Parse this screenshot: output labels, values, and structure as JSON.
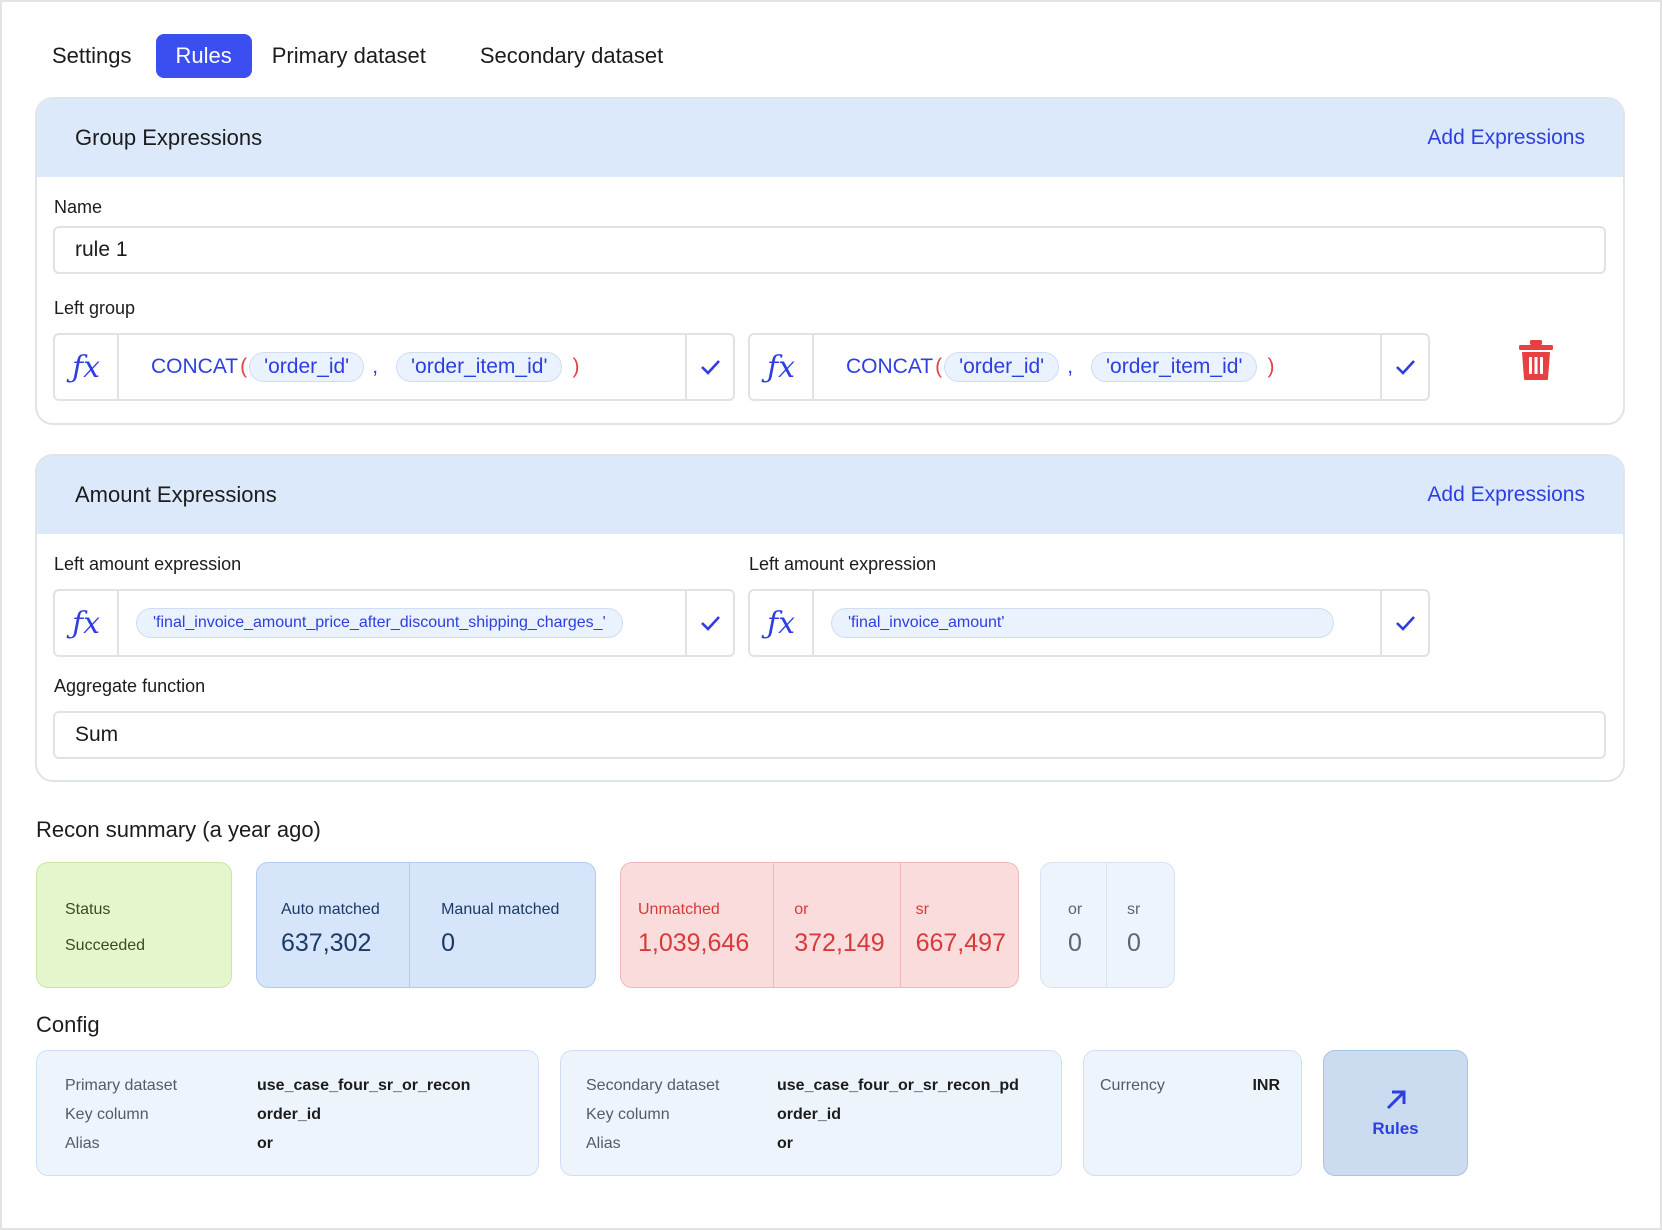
{
  "tabs": [
    {
      "label": "Settings",
      "active": false
    },
    {
      "label": "Rules",
      "active": true
    },
    {
      "label": "Primary dataset",
      "active": false
    },
    {
      "label": "Secondary dataset",
      "active": false
    }
  ],
  "group_expressions": {
    "title": "Group Expressions",
    "add_label": "Add Expressions",
    "name_label": "Name",
    "name_value": "rule 1",
    "left_group_label": "Left group",
    "expressions": [
      {
        "fn": "CONCAT",
        "args": [
          "'order_id'",
          "'order_item_id'"
        ]
      },
      {
        "fn": "CONCAT",
        "args": [
          "'order_id'",
          "'order_item_id'"
        ]
      }
    ]
  },
  "amount_expressions": {
    "title": "Amount Expressions",
    "add_label": "Add Expressions",
    "left_label_1": "Left amount expression",
    "left_label_2": "Left amount expression",
    "expr_1": "'final_invoice_amount_price_after_discount_shipping_charges_'",
    "expr_2": "'final_invoice_amount'",
    "aggregate_label": "Aggregate function",
    "aggregate_value": "Sum"
  },
  "recon_summary": {
    "title": "Recon summary (a year ago)",
    "status_label": "Status",
    "status_value": "Succeeded",
    "auto_matched_label": "Auto matched",
    "auto_matched_value": "637,302",
    "manual_matched_label": "Manual matched",
    "manual_matched_value": "0",
    "unmatched_label": "Unmatched",
    "unmatched_value": "1,039,646",
    "unmatched_or_label": "or",
    "unmatched_or_value": "372,149",
    "unmatched_sr_label": "sr",
    "unmatched_sr_value": "667,497",
    "extra_or_label": "or",
    "extra_or_value": "0",
    "extra_sr_label": "sr",
    "extra_sr_value": "0"
  },
  "config": {
    "title": "Config",
    "primary": {
      "dataset_key": "Primary dataset",
      "dataset_val": "use_case_four_sr_or_recon",
      "key_column_key": "Key column",
      "key_column_val": "order_id",
      "alias_key": "Alias",
      "alias_val": "or"
    },
    "secondary": {
      "dataset_key": "Secondary dataset",
      "dataset_val": "use_case_four_or_sr_recon_pd",
      "key_column_key": "Key column",
      "key_column_val": "order_id",
      "alias_key": "Alias",
      "alias_val": "or"
    },
    "currency_key": "Currency",
    "currency_val": "INR",
    "rules_button": "Rules"
  },
  "icons": {
    "fx": "function-icon",
    "check": "check-icon",
    "trash": "trash-icon",
    "arrow": "arrow-up-right-icon"
  },
  "fx_glyph": "ƒx",
  "colors": {
    "accent": "#3b4ff0",
    "link": "#2d3fe0",
    "danger": "#e04444",
    "header_bg": "#dce9fb",
    "status_green": "#e4f7cc",
    "matched_blue": "#d6e5f9",
    "unmatched_red": "#fbdcdc"
  }
}
